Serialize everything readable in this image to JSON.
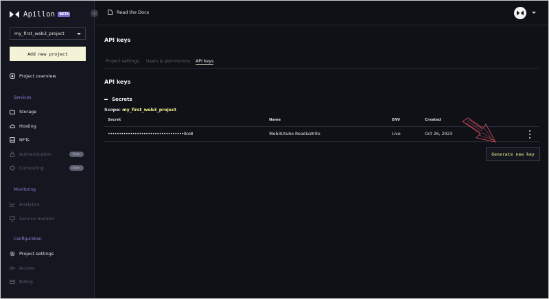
{
  "brand": {
    "name": "Apillon",
    "badge": "BETA"
  },
  "sidebar": {
    "project": "my_first_web3_project",
    "add_project": "Add new project",
    "overview": "Project overview",
    "sections": {
      "services": "Services",
      "monitoring": "Monitoring",
      "configuration": "Configuration"
    },
    "services": [
      {
        "label": "Storage",
        "icon": "folder-icon"
      },
      {
        "label": "Hosting",
        "icon": "cloud-icon"
      },
      {
        "label": "NFTs",
        "icon": "nft-icon"
      },
      {
        "label": "Authentication",
        "icon": "lock-icon",
        "disabled": true,
        "badge": "Soon"
      },
      {
        "label": "Computing",
        "icon": "chip-icon",
        "disabled": true,
        "badge": "Soon"
      }
    ],
    "monitoring": [
      {
        "label": "Analytics",
        "icon": "chart-icon",
        "disabled": true
      },
      {
        "label": "Service monitor",
        "icon": "monitor-icon",
        "disabled": true
      }
    ],
    "configuration": [
      {
        "label": "Project settings",
        "icon": "gear-icon"
      },
      {
        "label": "Access",
        "icon": "key-icon",
        "disabled": true
      },
      {
        "label": "Billing",
        "icon": "card-icon",
        "disabled": true
      }
    ]
  },
  "header": {
    "docs": "Read the Docs"
  },
  "main": {
    "title": "API keys",
    "tabs": [
      {
        "label": "Project settings"
      },
      {
        "label": "Users & permissions"
      },
      {
        "label": "API keys",
        "active": true
      }
    ],
    "section_title": "API keys",
    "secrets_label": "Secrets",
    "scope_label": "Scope:",
    "scope_value": "my_first_web3_project",
    "table": {
      "headers": {
        "secret": "Secret",
        "name": "Name",
        "env": "ENV",
        "created": "Created"
      },
      "rows": [
        {
          "secret": "••••••••••••••••••••••••••••••••••0ce8",
          "name": "Web3Utube Read&Write",
          "env": "Live",
          "created": "Oct 26, 2023"
        }
      ]
    },
    "generate_button": "Generate new key"
  },
  "colors": {
    "accent_yellow": "#f4f28c",
    "button_bg": "#f4f2d7",
    "section_purple": "#8d84d9",
    "arrow_red": "#c0485a"
  }
}
